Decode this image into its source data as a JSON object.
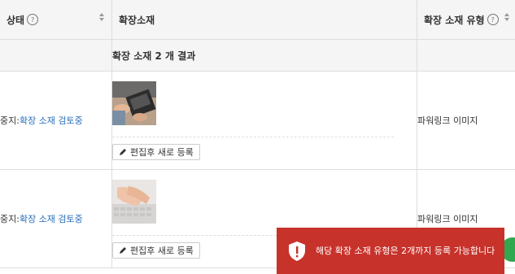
{
  "header": {
    "status_label": "상태",
    "extension_label": "확장소재",
    "type_label": "확장 소재 유형",
    "help_glyph": "?"
  },
  "summary": {
    "text": "확장 소재 2 개 결과"
  },
  "rows": [
    {
      "status_prefix": "중지:",
      "status_link": "확장 소재 검토중",
      "button_label": "편집후 새로 등록",
      "type": "파워링크 이미지",
      "thumb_icon": "laptop-typing-photo"
    },
    {
      "status_prefix": "중지:",
      "status_link": "확장 소재 검토중",
      "button_label": "편집후 새로 등록",
      "type": "파워링크 이미지",
      "thumb_icon": "keyboard-hands-photo"
    }
  ],
  "toast": {
    "message": "해당 확장 소재 유형은 2개까지 등록 가능합니다",
    "color": "#c7322b"
  },
  "colors": {
    "link": "#2a6ebb",
    "header_bg": "#f5f5f5",
    "fab": "#2fa84f"
  }
}
